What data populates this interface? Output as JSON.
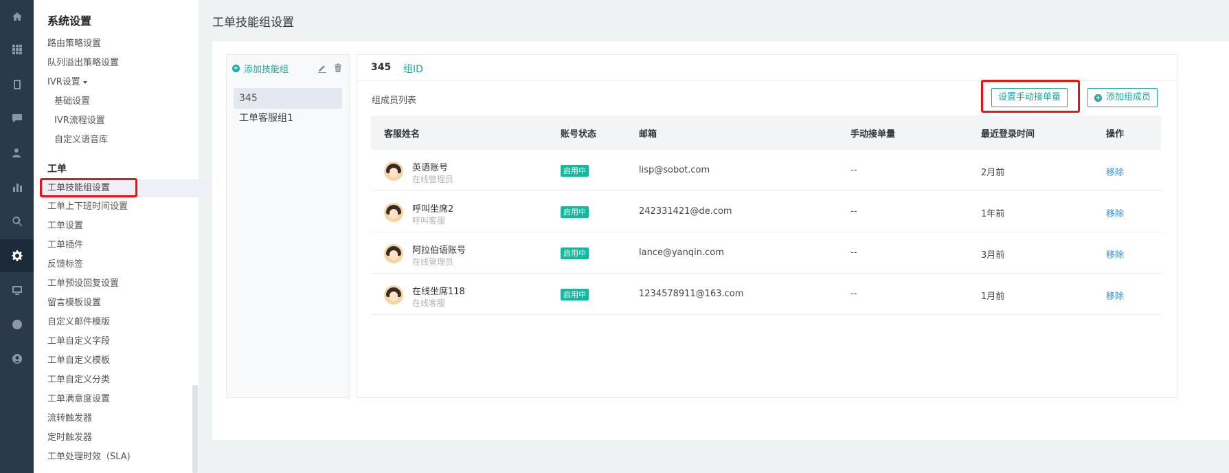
{
  "rail": {
    "icons": [
      "home-icon",
      "apps-icon",
      "book-icon",
      "chat-icon",
      "users-icon",
      "chart-icon",
      "search-icon",
      "settings-icon",
      "monitor-icon",
      "robot-icon",
      "user-circle-icon"
    ],
    "active": "settings-icon"
  },
  "sidebar": {
    "title": "系统设置",
    "items": [
      "路由策略设置",
      "队列溢出策略设置",
      "IVR设置"
    ],
    "ivr_subitems": [
      "基础设置",
      "IVR流程设置",
      "自定义语音库"
    ],
    "section": "工单",
    "ticket_items": [
      "工单技能组设置",
      "工单上下班时间设置",
      "工单设置",
      "工单插件",
      "反馈标签",
      "工单预设回复设置",
      "留言模板设置",
      "自定义邮件模版",
      "工单自定义字段",
      "工单自定义模板",
      "工单自定义分类",
      "工单满意度设置",
      "流转触发器",
      "定时触发器",
      "工单处理时效（SLA)"
    ]
  },
  "page": {
    "title": "工单技能组设置"
  },
  "groups": {
    "add_label": "添加技能组",
    "items": [
      "345",
      "工单客服组1"
    ]
  },
  "detail": {
    "group_name": "345",
    "group_id_label": "组ID",
    "list_label": "组成员列表",
    "set_manual_button": "设置手动接单量",
    "add_member_button": "添加组成员",
    "columns": [
      "客服姓名",
      "账号状态",
      "邮箱",
      "手动接单量",
      "最近登录时间",
      "操作"
    ],
    "rows": [
      {
        "name": "英语账号",
        "role": "在线管理员",
        "status": "启用中",
        "email": "lisp@sobot.com",
        "manual": "--",
        "last_login": "2月前",
        "action": "移除"
      },
      {
        "name": "呼叫坐席2",
        "role": "呼叫客服",
        "status": "启用中",
        "email": "242331421@de.com",
        "manual": "--",
        "last_login": "1年前",
        "action": "移除"
      },
      {
        "name": "阿拉伯语账号",
        "role": "在线管理员",
        "status": "启用中",
        "email": "lance@yanqin.com",
        "manual": "--",
        "last_login": "3月前",
        "action": "移除"
      },
      {
        "name": "在线坐席118",
        "role": "在线客服",
        "status": "启用中",
        "email": "1234578911@163.com",
        "manual": "--",
        "last_login": "1月前",
        "action": "移除"
      }
    ]
  },
  "colors": {
    "accent": "#19a7a0",
    "badge": "#19b59c",
    "link": "#3b8ed9",
    "highlight": "#ee1111",
    "rail": "#2a3a4a"
  }
}
